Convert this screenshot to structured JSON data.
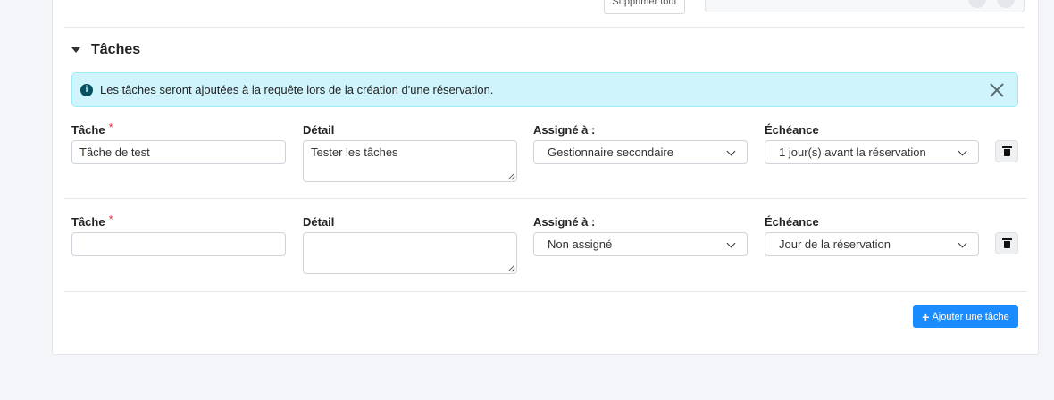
{
  "top": {
    "delete_all_label": "Supprimer tout"
  },
  "section": {
    "title": "Tâches"
  },
  "alert": {
    "text": "Les tâches seront ajoutées à la requête lors de la création d'une réservation."
  },
  "labels": {
    "task": "Tâche",
    "required_mark": "*",
    "detail": "Détail",
    "assigned": "Assigné à :",
    "due": "Échéance"
  },
  "tasks": [
    {
      "task_value": "Tâche de test",
      "detail_value": "Tester les tâches",
      "assigned_value": "Gestionnaire secondaire",
      "due_value": "1 jour(s) avant la réservation"
    },
    {
      "task_value": "",
      "detail_value": "",
      "assigned_value": "Non assigné",
      "due_value": "Jour de la réservation"
    }
  ],
  "add_button": {
    "plus": "+",
    "label": "Ajouter une tâche"
  },
  "colors": {
    "primary": "#1a8cff",
    "alert_bg": "#cff4fc",
    "required": "#dc3545"
  }
}
